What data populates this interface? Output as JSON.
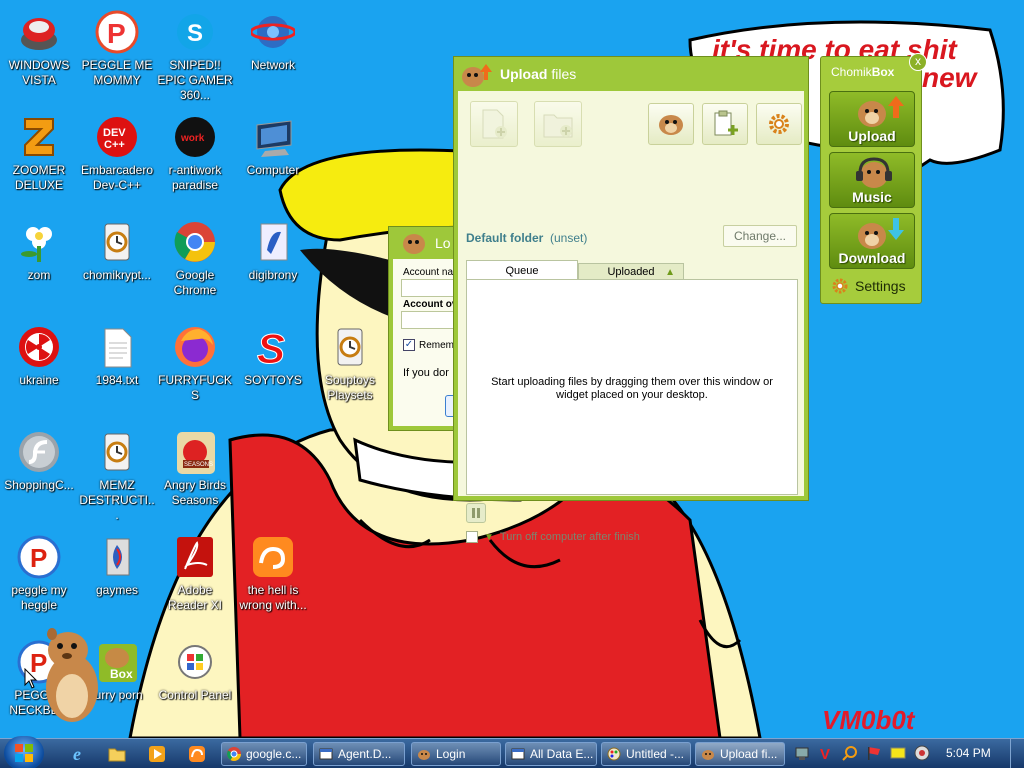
{
  "desktop": {
    "icons": [
      {
        "label": "WINDOWS VISTA",
        "icon": "vista-icon"
      },
      {
        "label": "PEGGLE ME MOMMY",
        "icon": "peggle-icon"
      },
      {
        "label": "SNIPED!! EPIC GAMER 360...",
        "icon": "skype-icon"
      },
      {
        "label": "Network",
        "icon": "network-icon"
      },
      {
        "label": "ZOOMER DELUXE",
        "icon": "zoomer-icon"
      },
      {
        "label": "Embarcadero Dev-C++",
        "icon": "devcpp-icon"
      },
      {
        "label": "r-antiwork paradise",
        "icon": "antiwork-icon"
      },
      {
        "label": "Computer",
        "icon": "computer-icon"
      },
      {
        "label": "zom",
        "icon": "flower-icon"
      },
      {
        "label": "chomikrypt...",
        "icon": "shortcut-icon"
      },
      {
        "label": "Google Chrome",
        "icon": "chrome-icon"
      },
      {
        "label": "digibrony",
        "icon": "digibrony-icon"
      },
      {
        "label": "ukraine",
        "icon": "radiation-icon"
      },
      {
        "label": "1984.txt",
        "icon": "text-file-icon"
      },
      {
        "label": "FURRYFUCKS",
        "icon": "firefox-icon"
      },
      {
        "label": "SOYTOYS",
        "icon": "soytoys-icon"
      },
      {
        "label": "Souptoys Playsets",
        "icon": "shortcut-icon"
      },
      {
        "label": "ShoppingC...",
        "icon": "flash-icon"
      },
      {
        "label": "MEMZ DESTRUCTI...",
        "icon": "shortcut-icon"
      },
      {
        "label": "Angry Birds Seasons",
        "icon": "angry-birds-icon"
      },
      {
        "label": "peggle my heggle",
        "icon": "peggle-icon"
      },
      {
        "label": "gaymes",
        "icon": "games-icon"
      },
      {
        "label": "Adobe Reader XI",
        "icon": "adobe-reader-icon"
      },
      {
        "label": "the hell is wrong with...",
        "icon": "uc-browser-icon"
      },
      {
        "label": "PEGGLE NECKBE...",
        "icon": "peggle-icon"
      },
      {
        "label": "furry porn",
        "icon": "chomikbox-icon"
      },
      {
        "label": "Control Panel",
        "icon": "control-panel-icon"
      }
    ]
  },
  "wallpaper": {
    "bubble_line1": "it's time to eat shit",
    "bubble_line2": "new",
    "signature": "VM0b0t"
  },
  "login_window": {
    "title": "Lo",
    "account_name_label": "Account na",
    "account_password_label": "Account ov",
    "remember_label": "Rememi",
    "hint": "If you dor"
  },
  "upload_window": {
    "title_bold": "Upload",
    "title_rest": " files",
    "default_folder_label": "Default folder",
    "default_folder_value": "(unset)",
    "change_button": "Change...",
    "tabs": [
      "Queue",
      "Uploaded"
    ],
    "queue_message": "Start uploading files by dragging them over this window or widget placed on your desktop.",
    "shutdown_label": "Turn off computer after finish"
  },
  "widget": {
    "title_bold": "Chomik",
    "title_rest": "Box",
    "close": "x",
    "buttons": [
      "Upload",
      "Music",
      "Download"
    ],
    "settings": "Settings"
  },
  "taskbar": {
    "items": [
      {
        "label": "google.c...",
        "icon": "chrome-icon"
      },
      {
        "label": "Agent.D...",
        "icon": "window-icon"
      },
      {
        "label": "Login",
        "icon": "hamster-icon"
      },
      {
        "label": "All Data E...",
        "icon": "window-icon"
      },
      {
        "label": "Untitled -...",
        "icon": "paint-icon"
      },
      {
        "label": "Upload fi...",
        "icon": "hamster-icon"
      }
    ],
    "clock": "5:04 PM"
  },
  "colors": {
    "desktop_bg": "#1aa3f0",
    "chomik_green": "#9ec83a",
    "taskbar": "#1d3f72"
  }
}
